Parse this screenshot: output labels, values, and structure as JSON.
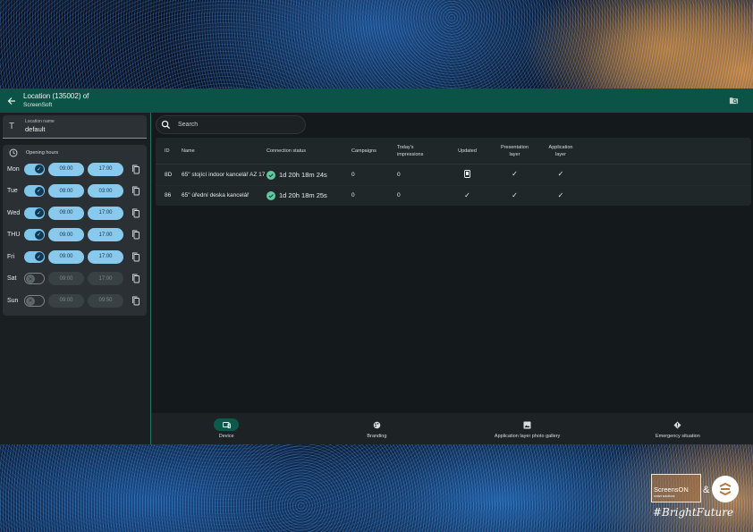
{
  "header": {
    "title": "Location (135002) of",
    "subtitle": "ScreenSoft",
    "back_icon": "arrow-left-icon",
    "action_icon": "folder-search-icon"
  },
  "sidebar": {
    "name_field": {
      "label": "Location name",
      "value": "default"
    },
    "opening_hours": {
      "title": "Opening hours",
      "days": [
        {
          "day": "Mon",
          "enabled": true,
          "open": "09:00",
          "close": "17:00"
        },
        {
          "day": "Tue",
          "enabled": true,
          "open": "09:00",
          "close": "03:00"
        },
        {
          "day": "Wed",
          "enabled": true,
          "open": "09:00",
          "close": "17:00"
        },
        {
          "day": "THU",
          "enabled": true,
          "open": "09:00",
          "close": "17:00"
        },
        {
          "day": "Fri",
          "enabled": true,
          "open": "09:00",
          "close": "17:00"
        },
        {
          "day": "Sat",
          "enabled": false,
          "open": "09:00",
          "close": "17:00"
        },
        {
          "day": "Sun",
          "enabled": false,
          "open": "09:00",
          "close": "09:50"
        }
      ]
    }
  },
  "search": {
    "placeholder": "Search",
    "value": ""
  },
  "table": {
    "headers": {
      "id": "ID",
      "name": "Name",
      "connection": "Connection status",
      "campaigns": "Campaigns",
      "impressions_1": "Today's",
      "impressions_2": "impressions",
      "updated": "Updated",
      "presentation_1": "Presentation",
      "presentation_2": "layer",
      "application_1": "Application",
      "application_2": "layer"
    },
    "rows": [
      {
        "id": "8D",
        "name": "65\" stojící indoor kancelář AZ 17",
        "connection": "1d 20h 18m 24s",
        "campaigns": "0",
        "impressions": "0",
        "updated": "phone-icon",
        "presentation": "✓",
        "application": "✓"
      },
      {
        "id": "86",
        "name": "65\" úřední deska kancelář",
        "connection": "1d 20h 18m 25s",
        "campaigns": "0",
        "impressions": "0",
        "updated": "✓",
        "presentation": "✓",
        "application": "✓"
      }
    ]
  },
  "bottom_nav": [
    {
      "label": "Device",
      "icon": "devices-icon",
      "active": true
    },
    {
      "label": "Branding",
      "icon": "palette-icon",
      "active": false
    },
    {
      "label": "Application layer photo gallery",
      "icon": "image-icon",
      "active": false
    },
    {
      "label": "Emergency situation",
      "icon": "diamond-icon",
      "active": false
    }
  ],
  "watermark": {
    "brand": "ScreensON",
    "brand_sub": "smart solutions",
    "amp": "&",
    "tagline": "#BrightFuture"
  },
  "colors": {
    "topbar": "#0b5346",
    "accent": "#7fc6ea",
    "status_ok": "#5ec9a0"
  }
}
